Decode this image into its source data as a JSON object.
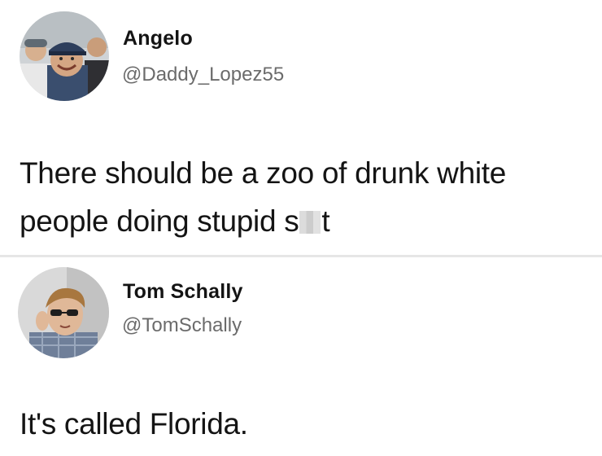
{
  "tweets": [
    {
      "display_name": "Angelo",
      "handle": "@Daddy_Lopez55",
      "text_line1": "There should be a zoo of drunk white",
      "text_line2_before": "people doing stupid s",
      "text_line2_after": "t",
      "avatar_icon": "group-photo-avatar"
    },
    {
      "display_name": "Tom Schally",
      "handle": "@TomSchally",
      "text": "It's called Florida.",
      "avatar_icon": "sunglasses-portrait-avatar"
    }
  ],
  "colors": {
    "background": "#ffffff",
    "name": "#141414",
    "handle": "#6b6b6b",
    "divider": "#e6e6e6"
  }
}
